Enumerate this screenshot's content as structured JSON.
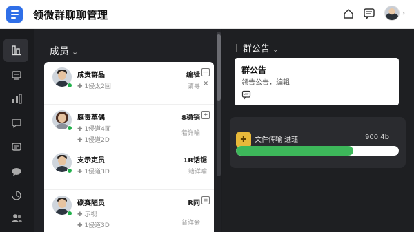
{
  "app": {
    "title": "领微群聊聊管理"
  },
  "members_panel": {
    "heading": "成员",
    "heading_chevron": "⌄"
  },
  "members": [
    {
      "name": "成责群品",
      "role_line": "✚ 1侵太2回",
      "action": "编辑",
      "action_sub": "请导"
    },
    {
      "name": "庭责革偶",
      "role_line": "✚ 1侵道4面",
      "role_line2": "✚ 1侵道2D",
      "action": "8稳销",
      "action_sub": "着详喻"
    },
    {
      "name": "支示吏员",
      "role_line": "✚ 1侵道3D",
      "action": "1R话锯",
      "action_sub": "籍详喻"
    },
    {
      "name": "碳赛陋员",
      "role_line": "✚ 示视",
      "role_line2": "✚ 1侵道3D",
      "action": "R同",
      "action_sub": "普详会"
    }
  ],
  "announcement": {
    "heading": "群公告",
    "card_title": "群公告",
    "card_body": "领告公告，编辑"
  },
  "transfer": {
    "label": "文件传输 进珏",
    "size": "900 4b",
    "progress": 0.72,
    "fill_color": "#3db75a"
  },
  "sidebar": {
    "active_index": 0
  }
}
